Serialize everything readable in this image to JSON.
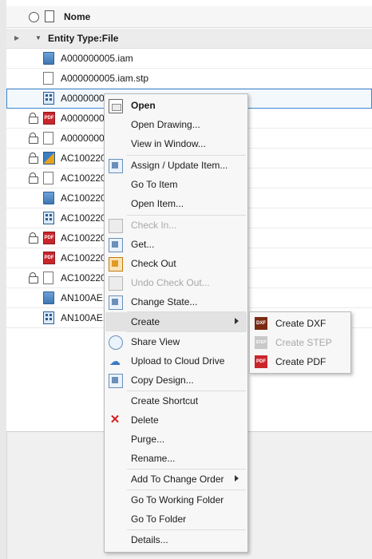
{
  "grid": {
    "header": {
      "name_col": "Nome"
    },
    "group": {
      "title": "Entity Type:File"
    },
    "rows": [
      {
        "name": "A000000005.iam",
        "icon": "assembly-file-icon",
        "locked": false,
        "selected": false
      },
      {
        "name": "A000000005.iam.stp",
        "icon": "document-icon",
        "locked": false,
        "selected": false
      },
      {
        "name": "A00000000",
        "icon": "drawing-file-icon",
        "locked": false,
        "selected": true
      },
      {
        "name": "A00000000",
        "icon": "pdf-file-icon",
        "locked": true,
        "selected": false
      },
      {
        "name": "A00000000",
        "icon": "document-icon",
        "locked": true,
        "selected": false
      },
      {
        "name": "AC100220",
        "icon": "part-file-icon",
        "locked": true,
        "selected": false
      },
      {
        "name": "AC100220",
        "icon": "document-icon",
        "locked": true,
        "selected": false
      },
      {
        "name": "AC100220",
        "icon": "assembly-file-icon",
        "locked": false,
        "selected": false
      },
      {
        "name": "AC100220",
        "icon": "drawing-file-icon",
        "locked": false,
        "selected": false
      },
      {
        "name": "AC100220",
        "icon": "pdf-file-icon",
        "locked": true,
        "selected": false
      },
      {
        "name": "AC100220",
        "icon": "pdf-file-icon",
        "locked": false,
        "selected": false
      },
      {
        "name": "AC100220",
        "icon": "document-icon",
        "locked": true,
        "selected": false
      },
      {
        "name": "AN100AE.",
        "icon": "assembly-file-icon",
        "locked": false,
        "selected": false
      },
      {
        "name": "AN100AE.",
        "icon": "drawing-file-icon",
        "locked": false,
        "selected": false
      }
    ]
  },
  "context_menu": {
    "open": "Open",
    "open_drawing": "Open Drawing...",
    "view_in_window": "View in Window...",
    "assign_update_item": "Assign / Update Item...",
    "go_to_item": "Go To Item",
    "open_item": "Open Item...",
    "check_in": "Check In...",
    "get": "Get...",
    "check_out": "Check Out",
    "undo_check_out": "Undo Check Out...",
    "change_state": "Change State...",
    "create": "Create",
    "share_view": "Share View",
    "upload_cloud": "Upload to Cloud Drive",
    "copy_design": "Copy Design...",
    "create_shortcut": "Create Shortcut",
    "delete": "Delete",
    "purge": "Purge...",
    "rename": "Rename...",
    "add_to_change_order": "Add To Change Order",
    "go_to_working_folder": "Go To Working Folder",
    "go_to_folder": "Go To Folder",
    "details": "Details..."
  },
  "create_submenu": {
    "dxf": "Create DXF",
    "step": "Create STEP",
    "pdf": "Create PDF",
    "icon_text": {
      "dxf": "DXF",
      "step": "STEP",
      "pdf": "PDF"
    }
  }
}
